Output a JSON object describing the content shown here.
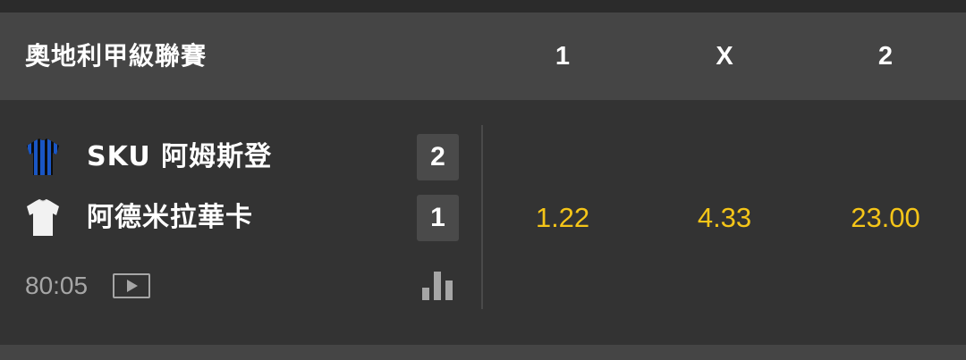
{
  "header": {
    "league": "奧地利甲級聯賽",
    "col_home": "1",
    "col_draw": "X",
    "col_away": "2"
  },
  "match": {
    "home": {
      "name": "SKU 阿姆斯登",
      "score": "2",
      "jersey_icon": "striped-jersey-icon",
      "jersey_colors": [
        "#1a56c4",
        "#0c0c0c"
      ]
    },
    "away": {
      "name": "阿德米拉華卡",
      "score": "1",
      "jersey_icon": "white-jersey-icon",
      "jersey_color": "#f2f2f2"
    },
    "time": "80:05",
    "odds": {
      "home": "1.22",
      "draw": "4.33",
      "away": "23.00"
    }
  },
  "colors": {
    "odds": "#f5c518",
    "header_bg": "#454545",
    "row_bg": "#333333"
  }
}
